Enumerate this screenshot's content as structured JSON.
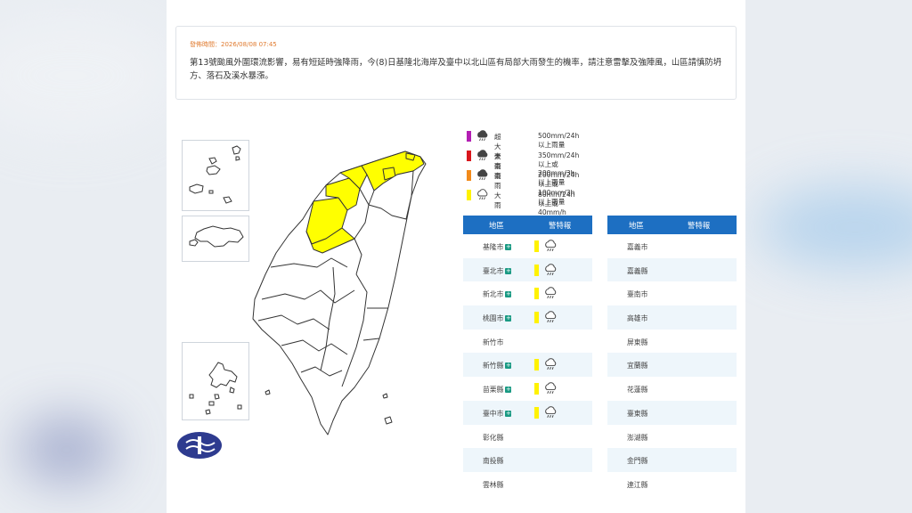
{
  "notice": {
    "time_label": "發佈時間：2026/08/08 07:45",
    "message": "第13號颱風外圍環流影響，易有短延時強降雨，今(8)日基隆北海岸及臺中以北山區有局部大雨發生的機率，請注意雷擊及強陣風，山區請慎防坍方、落石及溪水暴漲。"
  },
  "legend": [
    {
      "name": "超大豪雨",
      "desc": "500mm/24h 以上雨量",
      "color": "#b31eb3",
      "icon": "heavy-rain-icon"
    },
    {
      "name": "大豪雨",
      "desc": "350mm/24h 以上或 200mm/3h 以上雨量",
      "color": "#d9161c",
      "icon": "heavy-rain-icon"
    },
    {
      "name": "豪雨",
      "desc": "200mm/24h 以上或 100mm/3h 以上雨量",
      "color": "#f28a1a",
      "icon": "heavy-rain-icon"
    },
    {
      "name": "大雨",
      "desc": "80mm/24h 以上或 40mm/h 以上雨量",
      "color": "#fff200",
      "icon": "rain-icon"
    }
  ],
  "table_headers": {
    "region": "地區",
    "warning": "警特報"
  },
  "left_regions": [
    {
      "name": "基隆市",
      "link": true,
      "warning": "大雨"
    },
    {
      "name": "臺北市",
      "link": true,
      "warning": "大雨"
    },
    {
      "name": "新北市",
      "link": true,
      "warning": "大雨"
    },
    {
      "name": "桃園市",
      "link": true,
      "warning": "大雨"
    },
    {
      "name": "新竹市",
      "link": false,
      "warning": ""
    },
    {
      "name": "新竹縣",
      "link": true,
      "warning": "大雨"
    },
    {
      "name": "苗栗縣",
      "link": true,
      "warning": "大雨"
    },
    {
      "name": "臺中市",
      "link": true,
      "warning": "大雨"
    },
    {
      "name": "彰化縣",
      "link": false,
      "warning": ""
    },
    {
      "name": "南投縣",
      "link": false,
      "warning": ""
    },
    {
      "name": "雲林縣",
      "link": false,
      "warning": ""
    }
  ],
  "right_regions": [
    {
      "name": "嘉義市"
    },
    {
      "name": "嘉義縣"
    },
    {
      "name": "臺南市"
    },
    {
      "name": "高雄市"
    },
    {
      "name": "屏東縣"
    },
    {
      "name": "宜蘭縣"
    },
    {
      "name": "花蓮縣"
    },
    {
      "name": "臺東縣"
    },
    {
      "name": "澎湖縣"
    },
    {
      "name": "金門縣"
    },
    {
      "name": "連江縣"
    }
  ],
  "map_colors": {
    "heavy_rain": "#ffff00",
    "none": "#ffffff",
    "border": "#333333"
  }
}
